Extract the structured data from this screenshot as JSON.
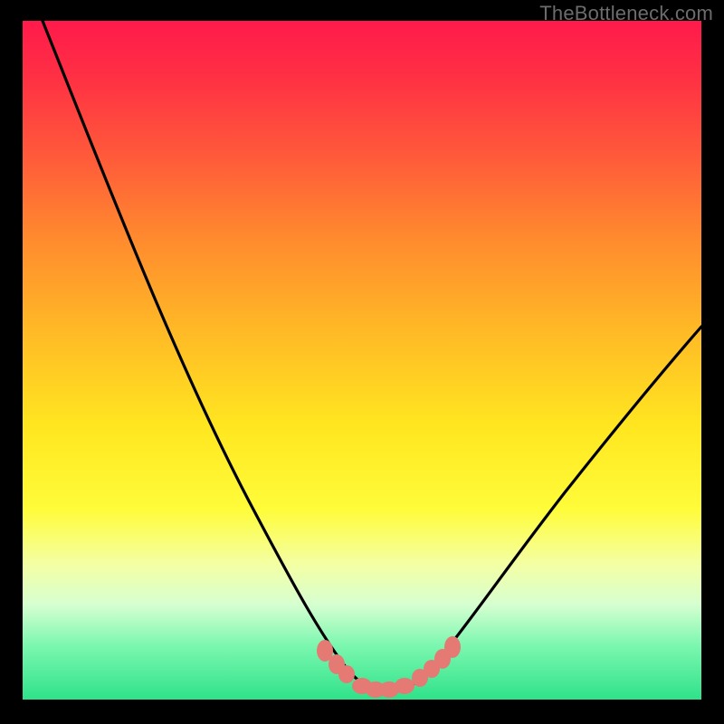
{
  "watermark": "TheBottleneck.com",
  "chart_data": {
    "type": "line",
    "title": "",
    "xlabel": "",
    "ylabel": "",
    "xlim": [
      0,
      100
    ],
    "ylim": [
      0,
      100
    ],
    "series": [
      {
        "name": "bottleneck-curve",
        "x": [
          3,
          10,
          18,
          25,
          32,
          38,
          42,
          45,
          48,
          50,
          52,
          54,
          56,
          58,
          60,
          63,
          68,
          75,
          82,
          90,
          100
        ],
        "values": [
          100,
          80,
          60,
          42,
          28,
          17,
          10,
          6,
          3,
          1.5,
          1,
          1,
          1,
          1.5,
          3,
          6,
          12,
          20,
          28,
          36,
          45
        ]
      }
    ],
    "markers": {
      "name": "highlight-cluster",
      "x": [
        44.5,
        46.3,
        47.8,
        50.0,
        52.0,
        54.0,
        56.2,
        58.5,
        60.2,
        61.8,
        63.3
      ],
      "y": [
        7.2,
        5.2,
        3.8,
        2.0,
        1.5,
        1.5,
        2.0,
        3.2,
        4.5,
        6.0,
        7.8
      ]
    },
    "gradient_stops": [
      {
        "pos": 0.0,
        "color": "#ff1a4b"
      },
      {
        "pos": 0.2,
        "color": "#ff5a3a"
      },
      {
        "pos": 0.45,
        "color": "#ffb726"
      },
      {
        "pos": 0.72,
        "color": "#fffc3a"
      },
      {
        "pos": 0.86,
        "color": "#d6ffd0"
      },
      {
        "pos": 1.0,
        "color": "#2fe28a"
      }
    ]
  }
}
